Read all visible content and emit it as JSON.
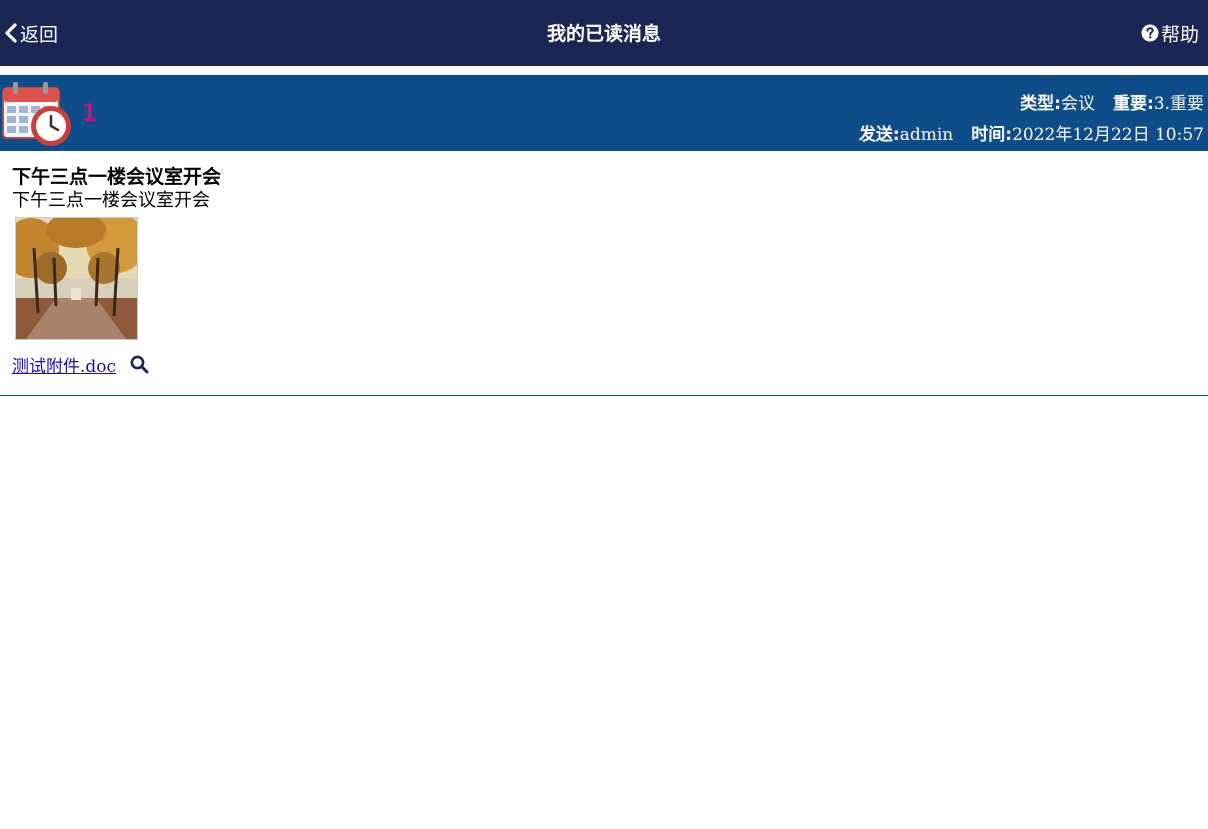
{
  "header": {
    "back_label": "返回",
    "title": "我的已读消息",
    "help_label": "帮助"
  },
  "message": {
    "index": "1",
    "type_label": "类型:",
    "type_value": "会议",
    "importance_label": "重要:",
    "importance_value": "3.重要",
    "sender_label": "发送:",
    "sender_value": "admin",
    "time_label": "时间:",
    "time_value": "2022年12月22日 10:57",
    "subject": "下午三点一楼会议室开会",
    "body": "下午三点一楼会议室开会",
    "attachment_name": "测试附件.doc"
  },
  "colors": {
    "topbar": "#1c2654",
    "message_header": "#0f4d8a",
    "index_color": "#c0167c",
    "link": "#1a0dab"
  },
  "icons": {
    "back": "chevron-left-icon",
    "help": "question-circle-icon",
    "message_type": "calendar-clock-icon",
    "preview": "search-icon"
  }
}
